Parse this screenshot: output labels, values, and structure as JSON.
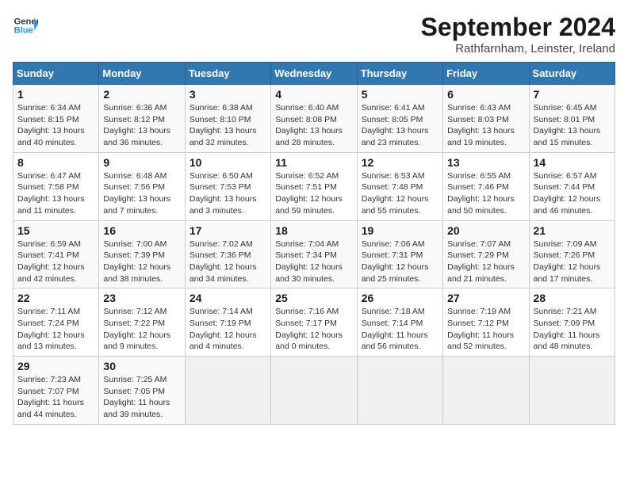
{
  "header": {
    "logo_general": "General",
    "logo_blue": "Blue",
    "month_title": "September 2024",
    "location": "Rathfarnham, Leinster, Ireland"
  },
  "calendar": {
    "days_of_week": [
      "Sunday",
      "Monday",
      "Tuesday",
      "Wednesday",
      "Thursday",
      "Friday",
      "Saturday"
    ],
    "weeks": [
      [
        {
          "day": "",
          "info": ""
        },
        {
          "day": "2",
          "info": "Sunrise: 6:36 AM\nSunset: 8:12 PM\nDaylight: 13 hours\nand 36 minutes."
        },
        {
          "day": "3",
          "info": "Sunrise: 6:38 AM\nSunset: 8:10 PM\nDaylight: 13 hours\nand 32 minutes."
        },
        {
          "day": "4",
          "info": "Sunrise: 6:40 AM\nSunset: 8:08 PM\nDaylight: 13 hours\nand 28 minutes."
        },
        {
          "day": "5",
          "info": "Sunrise: 6:41 AM\nSunset: 8:05 PM\nDaylight: 13 hours\nand 23 minutes."
        },
        {
          "day": "6",
          "info": "Sunrise: 6:43 AM\nSunset: 8:03 PM\nDaylight: 13 hours\nand 19 minutes."
        },
        {
          "day": "7",
          "info": "Sunrise: 6:45 AM\nSunset: 8:01 PM\nDaylight: 13 hours\nand 15 minutes."
        }
      ],
      [
        {
          "day": "1",
          "info": "Sunrise: 6:34 AM\nSunset: 8:15 PM\nDaylight: 13 hours\nand 40 minutes."
        },
        {
          "day": "9",
          "info": "Sunrise: 6:48 AM\nSunset: 7:56 PM\nDaylight: 13 hours\nand 7 minutes."
        },
        {
          "day": "10",
          "info": "Sunrise: 6:50 AM\nSunset: 7:53 PM\nDaylight: 13 hours\nand 3 minutes."
        },
        {
          "day": "11",
          "info": "Sunrise: 6:52 AM\nSunset: 7:51 PM\nDaylight: 12 hours\nand 59 minutes."
        },
        {
          "day": "12",
          "info": "Sunrise: 6:53 AM\nSunset: 7:48 PM\nDaylight: 12 hours\nand 55 minutes."
        },
        {
          "day": "13",
          "info": "Sunrise: 6:55 AM\nSunset: 7:46 PM\nDaylight: 12 hours\nand 50 minutes."
        },
        {
          "day": "14",
          "info": "Sunrise: 6:57 AM\nSunset: 7:44 PM\nDaylight: 12 hours\nand 46 minutes."
        }
      ],
      [
        {
          "day": "8",
          "info": "Sunrise: 6:47 AM\nSunset: 7:58 PM\nDaylight: 13 hours\nand 11 minutes."
        },
        {
          "day": "16",
          "info": "Sunrise: 7:00 AM\nSunset: 7:39 PM\nDaylight: 12 hours\nand 38 minutes."
        },
        {
          "day": "17",
          "info": "Sunrise: 7:02 AM\nSunset: 7:36 PM\nDaylight: 12 hours\nand 34 minutes."
        },
        {
          "day": "18",
          "info": "Sunrise: 7:04 AM\nSunset: 7:34 PM\nDaylight: 12 hours\nand 30 minutes."
        },
        {
          "day": "19",
          "info": "Sunrise: 7:06 AM\nSunset: 7:31 PM\nDaylight: 12 hours\nand 25 minutes."
        },
        {
          "day": "20",
          "info": "Sunrise: 7:07 AM\nSunset: 7:29 PM\nDaylight: 12 hours\nand 21 minutes."
        },
        {
          "day": "21",
          "info": "Sunrise: 7:09 AM\nSunset: 7:26 PM\nDaylight: 12 hours\nand 17 minutes."
        }
      ],
      [
        {
          "day": "15",
          "info": "Sunrise: 6:59 AM\nSunset: 7:41 PM\nDaylight: 12 hours\nand 42 minutes."
        },
        {
          "day": "23",
          "info": "Sunrise: 7:12 AM\nSunset: 7:22 PM\nDaylight: 12 hours\nand 9 minutes."
        },
        {
          "day": "24",
          "info": "Sunrise: 7:14 AM\nSunset: 7:19 PM\nDaylight: 12 hours\nand 4 minutes."
        },
        {
          "day": "25",
          "info": "Sunrise: 7:16 AM\nSunset: 7:17 PM\nDaylight: 12 hours\nand 0 minutes."
        },
        {
          "day": "26",
          "info": "Sunrise: 7:18 AM\nSunset: 7:14 PM\nDaylight: 11 hours\nand 56 minutes."
        },
        {
          "day": "27",
          "info": "Sunrise: 7:19 AM\nSunset: 7:12 PM\nDaylight: 11 hours\nand 52 minutes."
        },
        {
          "day": "28",
          "info": "Sunrise: 7:21 AM\nSunset: 7:09 PM\nDaylight: 11 hours\nand 48 minutes."
        }
      ],
      [
        {
          "day": "22",
          "info": "Sunrise: 7:11 AM\nSunset: 7:24 PM\nDaylight: 12 hours\nand 13 minutes."
        },
        {
          "day": "30",
          "info": "Sunrise: 7:25 AM\nSunset: 7:05 PM\nDaylight: 11 hours\nand 39 minutes."
        },
        {
          "day": "",
          "info": ""
        },
        {
          "day": "",
          "info": ""
        },
        {
          "day": "",
          "info": ""
        },
        {
          "day": "",
          "info": ""
        },
        {
          "day": "",
          "info": ""
        }
      ],
      [
        {
          "day": "29",
          "info": "Sunrise: 7:23 AM\nSunset: 7:07 PM\nDaylight: 11 hours\nand 44 minutes."
        },
        {
          "day": "",
          "info": ""
        },
        {
          "day": "",
          "info": ""
        },
        {
          "day": "",
          "info": ""
        },
        {
          "day": "",
          "info": ""
        },
        {
          "day": "",
          "info": ""
        },
        {
          "day": "",
          "info": ""
        }
      ]
    ]
  }
}
